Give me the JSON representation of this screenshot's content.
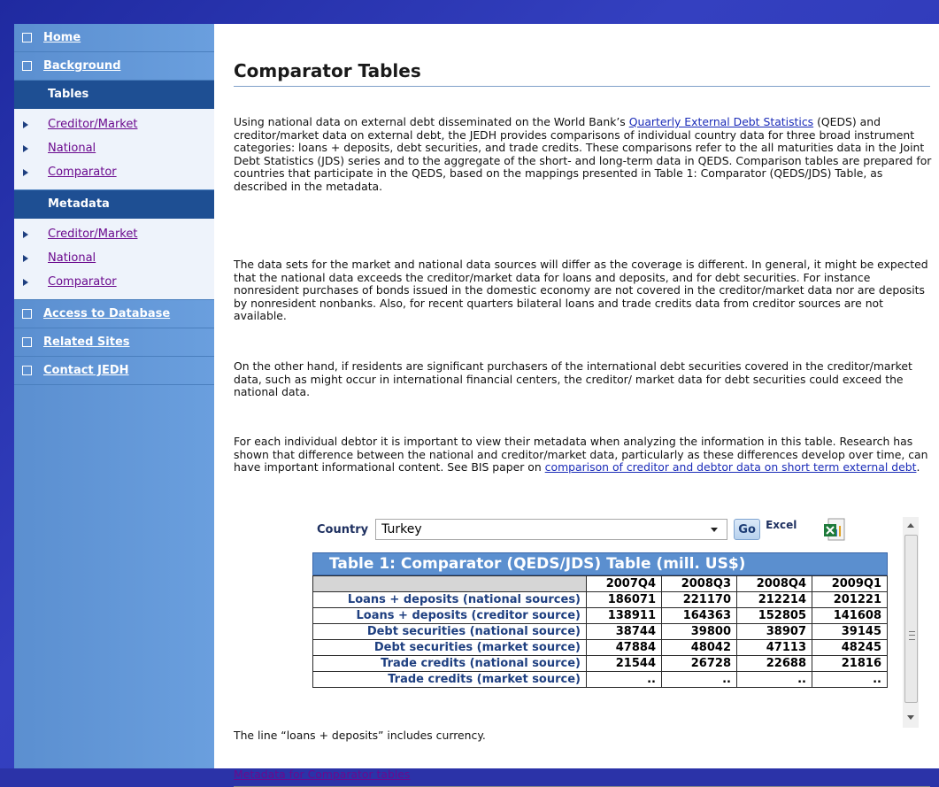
{
  "nav": {
    "top_items": [
      {
        "label": "Home"
      },
      {
        "label": "Background"
      }
    ],
    "tables_header": "Tables",
    "tables_items": [
      {
        "label": "Creditor/Market"
      },
      {
        "label": "National"
      },
      {
        "label": "Comparator"
      }
    ],
    "metadata_header": "Metadata",
    "metadata_items": [
      {
        "label": "Creditor/Market"
      },
      {
        "label": "National"
      },
      {
        "label": "Comparator"
      }
    ],
    "bottom_items": [
      {
        "label": "Access to Database"
      },
      {
        "label": "Related Sites"
      },
      {
        "label": "Contact JEDH"
      }
    ]
  },
  "page": {
    "title": "Comparator Tables",
    "p1": {
      "a": "Using national data on external debt disseminated on the World Bank’s ",
      "link": "Quarterly External Debt Statistics",
      "b": " (QEDS) and creditor/market data on external debt, the JEDH provides comparisons of individual country data for three broad instrument categories: loans + deposits, debt securities, and trade credits. These comparisons refer to the all maturities data in the Joint Debt Statistics (JDS) series and to the aggregate of the short- and long-term data in QEDS. Comparison tables are prepared for countries that participate in the QEDS, based on the mappings presented in Table 1: Comparator (QEDS/JDS) Table, as described in the metadata."
    },
    "p2": "The data sets for the market and national data sources will differ as the coverage is different. In general, it might be expected that the national data exceeds  the creditor/market data for loans and deposits, and for debt securities. For instance nonresident purchases of bonds issued in the domestic economy are not covered in the creditor/market data nor are deposits by nonresident nonbanks. Also, for recent quarters bilateral loans and trade credits data from creditor sources are not available.",
    "p3": "On the other hand, if residents are significant purchasers of the international debt securities covered in the creditor/market data, such as might occur in international financial centers, the creditor/ market data for debt securities could exceed the national data.",
    "p4": {
      "a": "For each individual debtor it is important to view their metadata when analyzing the information in this table. Research has shown that difference between the national and creditor/market data, particularly as these differences develop over time, can have important informational content. See BIS paper on ",
      "link": "comparison of creditor and debtor data on short term external debt",
      "b": "."
    },
    "footnote": "The line “loans + deposits” includes currency.",
    "metadata_link": "Metadata for Comparator tables"
  },
  "selector": {
    "label": "Country",
    "value": "Turkey",
    "go_label": "Go",
    "excel_label": "Excel",
    "excel_icon": "excel-icon"
  },
  "table": {
    "title": "Table 1: Comparator (QEDS/JDS) Table (mill. US$)",
    "columns": [
      "2007Q4",
      "2008Q3",
      "2008Q4",
      "2009Q1"
    ],
    "rows": [
      {
        "label": "Loans + deposits (national sources)",
        "values": [
          "186071",
          "221170",
          "212214",
          "201221"
        ]
      },
      {
        "label": "Loans + deposits (creditor source)",
        "values": [
          "138911",
          "164363",
          "152805",
          "141608"
        ]
      },
      {
        "label": "Debt securities (national source)",
        "values": [
          "38744",
          "39800",
          "38907",
          "39145"
        ]
      },
      {
        "label": "Debt securities (market source)",
        "values": [
          "47884",
          "48042",
          "47113",
          "48245"
        ]
      },
      {
        "label": "Trade credits (national source)",
        "values": [
          "21544",
          "26728",
          "22688",
          "21816"
        ]
      },
      {
        "label": "Trade credits (market source)",
        "values": [
          "..",
          "..",
          "..",
          ".."
        ]
      }
    ]
  },
  "colors": {
    "background": "#2b33a8",
    "nav": "#6a9fde",
    "nav_header": "#1e4f93",
    "table_title": "#5b8fcf",
    "link": "#1a2bb8",
    "visited_link": "#6b0a8e"
  }
}
